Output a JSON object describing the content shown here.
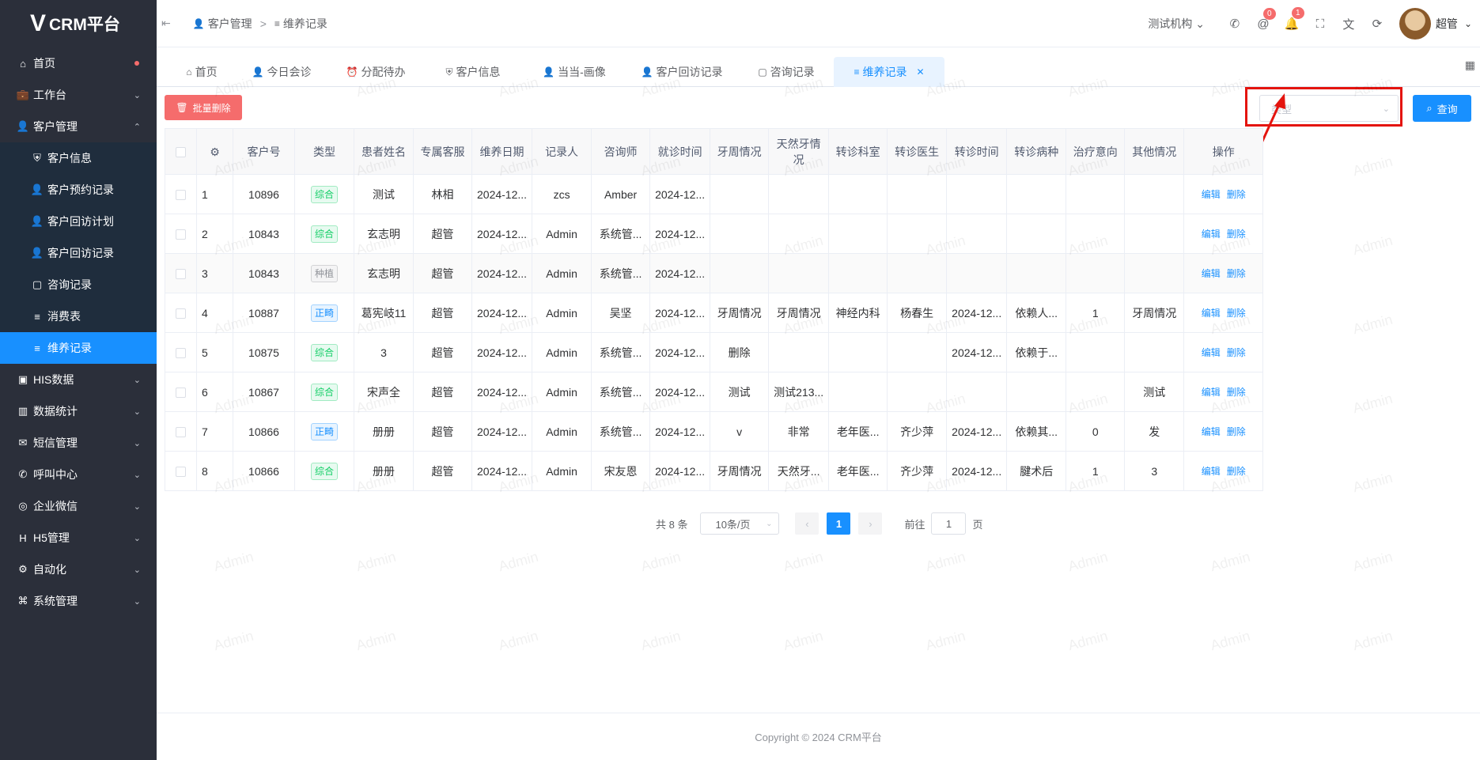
{
  "app": {
    "logo_mark": "V",
    "title": "CRM平台"
  },
  "sidebar": {
    "items": [
      {
        "label": "首页",
        "icon": "home-icon"
      },
      {
        "label": "工作台",
        "icon": "briefcase-icon"
      },
      {
        "label": "客户管理",
        "icon": "user-icon"
      },
      {
        "label": "客户信息",
        "icon": "shield-icon"
      },
      {
        "label": "客户预约记录",
        "icon": "user-icon"
      },
      {
        "label": "客户回访计划",
        "icon": "user-icon"
      },
      {
        "label": "客户回访记录",
        "icon": "user-icon"
      },
      {
        "label": "咨询记录",
        "icon": "chat-icon"
      },
      {
        "label": "消费表",
        "icon": "list-icon"
      },
      {
        "label": "维养记录",
        "icon": "list-icon"
      },
      {
        "label": "HIS数据",
        "icon": "his-icon"
      },
      {
        "label": "数据统计",
        "icon": "chart-icon"
      },
      {
        "label": "短信管理",
        "icon": "sms-icon"
      },
      {
        "label": "呼叫中心",
        "icon": "phone-icon"
      },
      {
        "label": "企业微信",
        "icon": "wechat-icon"
      },
      {
        "label": "H5管理",
        "icon": "h5-icon"
      },
      {
        "label": "自动化",
        "icon": "automation-icon"
      },
      {
        "label": "系统管理",
        "icon": "system-icon"
      }
    ]
  },
  "header": {
    "breadcrumb": [
      "客户管理",
      "维养记录"
    ],
    "breadcrumb_sep": ">",
    "org": "测试机构",
    "badge_at": "0",
    "badge_bell": "1",
    "username": "超管"
  },
  "tabs": [
    "首页",
    "今日会诊",
    "分配待办",
    "客户信息",
    "当当-画像",
    "客户回访记录",
    "咨询记录",
    "维养记录"
  ],
  "toolbar": {
    "batch_delete": "批量删除",
    "type_placeholder": "类型",
    "query": "查询"
  },
  "table": {
    "headers": [
      "客户号",
      "类型",
      "患者姓名",
      "专属客服",
      "维养日期",
      "记录人",
      "咨询师",
      "就诊时间",
      "牙周情况",
      "天然牙情况",
      "转诊科室",
      "转诊医生",
      "转诊时间",
      "转诊病种",
      "治疗意向",
      "其他情况",
      "操作"
    ],
    "edit_label": "编辑",
    "delete_label": "删除",
    "rows": [
      {
        "no": "1",
        "id": "10896",
        "type": "综合",
        "tag": "green",
        "name": "测试",
        "cs": "林相",
        "date": "2024-12...",
        "recorder": "zcs",
        "consultant": "Amber",
        "visit": "2024-12...",
        "perio": "",
        "natural": "",
        "dept": "",
        "doctor": "",
        "rtime": "",
        "disease": "",
        "intent": "",
        "other": ""
      },
      {
        "no": "2",
        "id": "10843",
        "type": "综合",
        "tag": "green",
        "name": "玄志明",
        "cs": "超管",
        "date": "2024-12...",
        "recorder": "Admin",
        "consultant": "系统管...",
        "visit": "2024-12...",
        "perio": "",
        "natural": "",
        "dept": "",
        "doctor": "",
        "rtime": "",
        "disease": "",
        "intent": "",
        "other": ""
      },
      {
        "no": "3",
        "id": "10843",
        "type": "种植",
        "tag": "gray",
        "name": "玄志明",
        "cs": "超管",
        "date": "2024-12...",
        "recorder": "Admin",
        "consultant": "系统管...",
        "visit": "2024-12...",
        "perio": "",
        "natural": "",
        "dept": "",
        "doctor": "",
        "rtime": "",
        "disease": "",
        "intent": "",
        "other": ""
      },
      {
        "no": "4",
        "id": "10887",
        "type": "正畸",
        "tag": "blue",
        "name": "葛宪岐11",
        "cs": "超管",
        "date": "2024-12...",
        "recorder": "Admin",
        "consultant": "吴坚",
        "visit": "2024-12...",
        "perio": "牙周情况",
        "natural": "牙周情况",
        "dept": "神经内科",
        "doctor": "杨春生",
        "rtime": "2024-12...",
        "disease": "依赖人...",
        "intent": "1",
        "other": "牙周情况"
      },
      {
        "no": "5",
        "id": "10875",
        "type": "综合",
        "tag": "green",
        "name": "3",
        "cs": "超管",
        "date": "2024-12...",
        "recorder": "Admin",
        "consultant": "系统管...",
        "visit": "2024-12...",
        "perio": "删除",
        "natural": "",
        "dept": "",
        "doctor": "",
        "rtime": "2024-12...",
        "disease": "依赖于...",
        "intent": "",
        "other": ""
      },
      {
        "no": "6",
        "id": "10867",
        "type": "综合",
        "tag": "green",
        "name": "宋声全",
        "cs": "超管",
        "date": "2024-12...",
        "recorder": "Admin",
        "consultant": "系统管...",
        "visit": "2024-12...",
        "perio": "测试",
        "natural": "测试213...",
        "dept": "",
        "doctor": "",
        "rtime": "",
        "disease": "",
        "intent": "",
        "other": "测试"
      },
      {
        "no": "7",
        "id": "10866",
        "type": "正畸",
        "tag": "blue",
        "name": "册册",
        "cs": "超管",
        "date": "2024-12...",
        "recorder": "Admin",
        "consultant": "系统管...",
        "visit": "2024-12...",
        "perio": "v",
        "natural": "非常",
        "dept": "老年医...",
        "doctor": "齐少萍",
        "rtime": "2024-12...",
        "disease": "依赖其...",
        "intent": "0",
        "other": "发"
      },
      {
        "no": "8",
        "id": "10866",
        "type": "综合",
        "tag": "green",
        "name": "册册",
        "cs": "超管",
        "date": "2024-12...",
        "recorder": "Admin",
        "consultant": "宋友恩",
        "visit": "2024-12...",
        "perio": "牙周情况",
        "natural": "天然牙...",
        "dept": "老年医...",
        "doctor": "齐少萍",
        "rtime": "2024-12...",
        "disease": "腱术后",
        "intent": "1",
        "other": "3"
      }
    ]
  },
  "pagination": {
    "total": "共 8 条",
    "page_size": "10条/页",
    "current": "1",
    "goto_label": "前往",
    "goto_value": "1",
    "page_unit": "页"
  },
  "footer": {
    "copyright": "Copyright © 2024 CRM平台"
  },
  "watermark": "Admin",
  "colors": {
    "sidebar": "#2b2f3a",
    "primary": "#1890ff",
    "danger": "#f56c6c",
    "highlight": "#e4140e"
  }
}
